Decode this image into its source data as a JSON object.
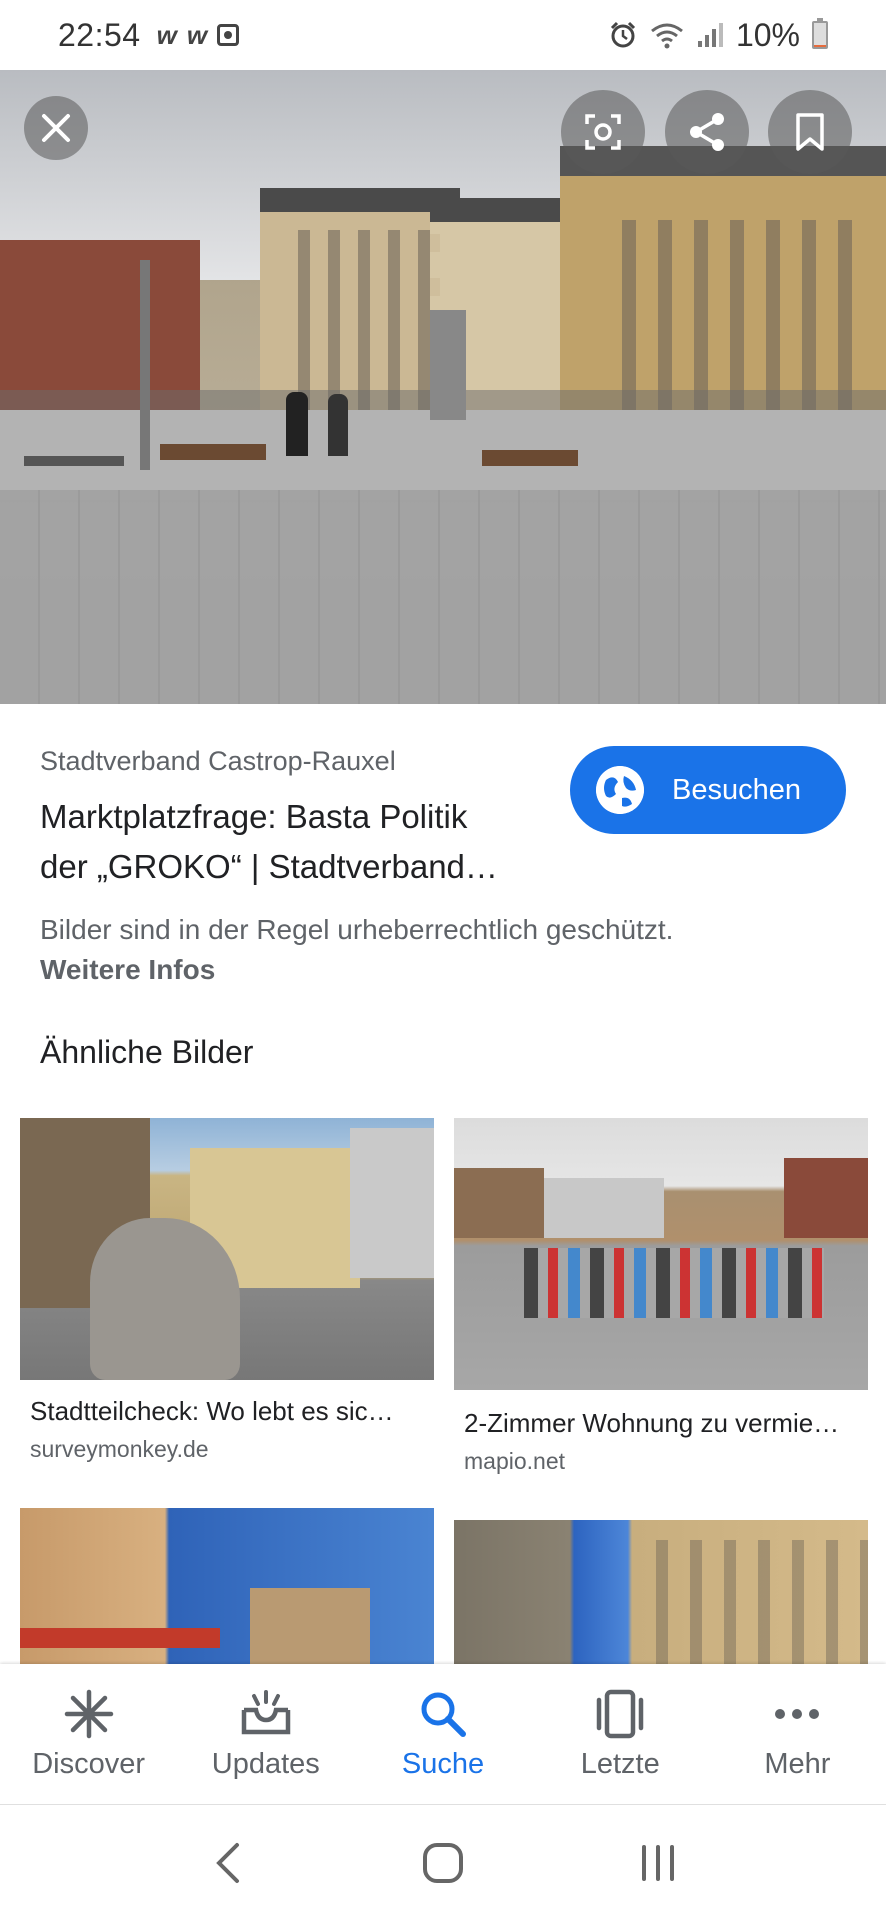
{
  "status_bar": {
    "time": "22:54",
    "left_icons": [
      "w-icon",
      "w-icon",
      "camera-icon"
    ],
    "battery": "10%",
    "right_icons": [
      "alarm-icon",
      "wifi-icon",
      "signal-icon",
      "battery-icon"
    ]
  },
  "hero": {
    "buttons": [
      "close-icon",
      "lens-icon",
      "share-icon",
      "bookmark-icon"
    ]
  },
  "result": {
    "source": "Stadtverband Castrop-Rauxel",
    "title_line1": "Marktplatzfrage: Basta Politik",
    "title_line2": "der „GROKO“ | Stadtverband…",
    "visit_label": "Besuchen",
    "copyright": "Bilder sind in der Regel urheberrechtlich geschützt.",
    "more_info": "Weitere Infos"
  },
  "similar": {
    "heading": "Ähnliche Bilder",
    "items": [
      {
        "title": "Stadtteilcheck: Wo lebt es sic…",
        "source": "surveymonkey.de"
      },
      {
        "title": "2-Zimmer Wohnung zu vermie…",
        "source": "mapio.net"
      }
    ]
  },
  "bottom_nav": {
    "items": [
      {
        "label": "Discover",
        "icon": "asterisk-icon"
      },
      {
        "label": "Updates",
        "icon": "updates-icon"
      },
      {
        "label": "Suche",
        "icon": "search-icon"
      },
      {
        "label": "Letzte",
        "icon": "recent-icon"
      },
      {
        "label": "Mehr",
        "icon": "more-icon"
      }
    ],
    "active": "Suche",
    "accent": "#1a73e8"
  },
  "system_nav": [
    "back-icon",
    "home-icon",
    "recents-icon"
  ]
}
